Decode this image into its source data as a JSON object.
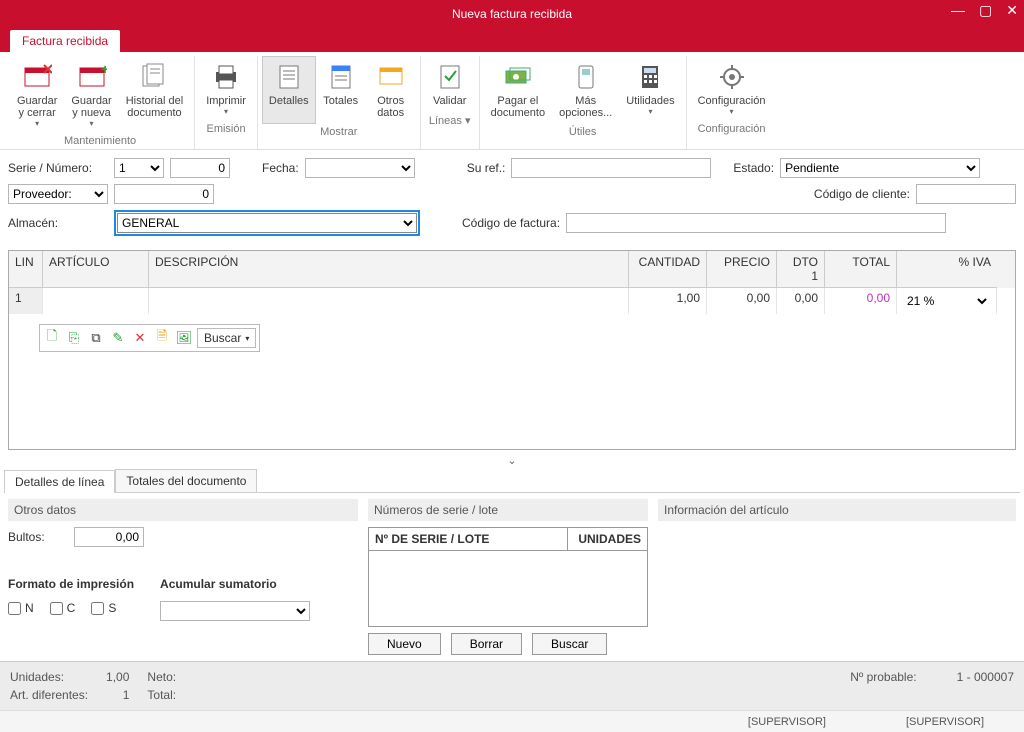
{
  "window": {
    "title": "Nueva factura recibida"
  },
  "tab": "Factura recibida",
  "ribbon": {
    "groups": [
      {
        "name": "Mantenimiento",
        "buttons": [
          {
            "id": "save-close",
            "label": "Guardar\ny cerrar",
            "caret": true
          },
          {
            "id": "save-new",
            "label": "Guardar\ny nueva",
            "caret": true
          },
          {
            "id": "doc-history",
            "label": "Historial del\ndocumento"
          }
        ]
      },
      {
        "name": "Emisión",
        "buttons": [
          {
            "id": "print",
            "label": "Imprimir",
            "caret": true
          }
        ]
      },
      {
        "name": "Mostrar",
        "buttons": [
          {
            "id": "details",
            "label": "Detalles",
            "active": true
          },
          {
            "id": "totals",
            "label": "Totales"
          },
          {
            "id": "other",
            "label": "Otros\ndatos"
          }
        ]
      },
      {
        "name": "Líneas",
        "caret": true,
        "buttons": [
          {
            "id": "validate",
            "label": "Validar"
          }
        ]
      },
      {
        "name": "Útiles",
        "buttons": [
          {
            "id": "pay",
            "label": "Pagar el\ndocumento"
          },
          {
            "id": "more",
            "label": "Más\nopciones...",
            "caret": true
          },
          {
            "id": "utils",
            "label": "Utilidades",
            "caret": true
          }
        ]
      },
      {
        "name": "Configuración",
        "buttons": [
          {
            "id": "config",
            "label": "Configuración",
            "caret": true
          }
        ]
      }
    ]
  },
  "form": {
    "serie_label": "Serie / Número:",
    "serie": "1",
    "numero": "0",
    "fecha_label": "Fecha:",
    "fecha": "",
    "suref_label": "Su ref.:",
    "suref": "",
    "estado_label": "Estado:",
    "estado": "Pendiente",
    "proveedor_label": "Proveedor:",
    "proveedor": "0",
    "codcli_label": "Código de cliente:",
    "codcli": "",
    "almacen_label": "Almacén:",
    "almacen": "GENERAL",
    "codfac_label": "Código de factura:",
    "codfac": ""
  },
  "grid": {
    "headers": {
      "lin": "LIN",
      "art": "ARTÍCULO",
      "desc": "DESCRIPCIÓN",
      "cant": "CANTIDAD",
      "precio": "PRECIO",
      "dto": "DTO 1",
      "total": "TOTAL",
      "iva": "% IVA"
    },
    "row": {
      "lin": "1",
      "art": "",
      "desc": "",
      "cant": "1,00",
      "precio": "0,00",
      "dto": "0,00",
      "total": "0,00",
      "iva": "21 %"
    },
    "buscar": "Buscar"
  },
  "subtabs": {
    "a": "Detalles de línea",
    "b": "Totales del documento"
  },
  "otros": {
    "title": "Otros datos",
    "bultos_label": "Bultos:",
    "bultos": "0,00",
    "fmt_title": "Formato de impresión",
    "acum_title": "Acumular sumatorio",
    "n": "N",
    "c": "C",
    "s": "S"
  },
  "serie_lote": {
    "title": "Números de serie / lote",
    "col1": "Nº DE SERIE / LOTE",
    "col2": "UNIDADES",
    "nuevo": "Nuevo",
    "borrar": "Borrar",
    "buscar": "Buscar"
  },
  "info_art": {
    "title": "Información del artículo"
  },
  "footer": {
    "unidades_l": "Unidades:",
    "unidades": "1,00",
    "neto_l": "Neto:",
    "art_l": "Art. diferentes:",
    "art": "1",
    "total_l": "Total:",
    "nprob_l": "Nº probable:",
    "nprob": "1 - 000007"
  },
  "status": {
    "a": "[SUPERVISOR]",
    "b": "[SUPERVISOR]"
  }
}
